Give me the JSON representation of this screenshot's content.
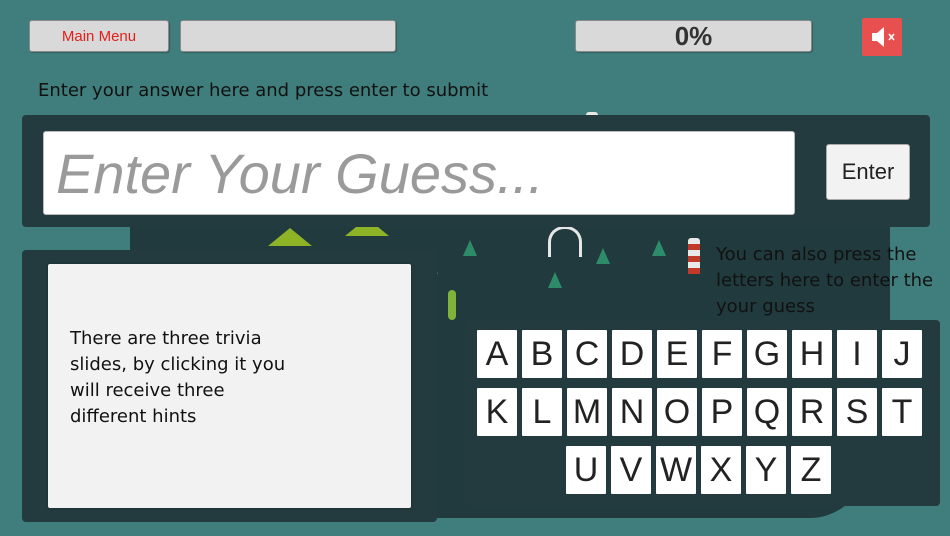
{
  "header": {
    "main_menu_label": "Main Menu",
    "progress_text": "0%",
    "progress_fraction": 0,
    "mute_icon": "speaker-muted-icon"
  },
  "guess": {
    "instruction": "Enter your answer here and press enter to submit",
    "placeholder": "Enter Your Guess...",
    "value": "",
    "enter_label": "Enter"
  },
  "hint": {
    "text": "There are three trivia slides, by clicking it you will receive three different hints"
  },
  "keyboard": {
    "instruction": "You can also press the letters here to enter the your guess",
    "rows": [
      [
        "A",
        "B",
        "C",
        "D",
        "E",
        "F",
        "G",
        "H",
        "I",
        "J"
      ],
      [
        "K",
        "L",
        "M",
        "N",
        "O",
        "P",
        "Q",
        "R",
        "S",
        "T"
      ],
      [
        "U",
        "V",
        "W",
        "X",
        "Y",
        "Z"
      ]
    ]
  },
  "colors": {
    "background": "#3f7e7c",
    "panel": "#233b3e",
    "main_menu_text": "#e3201b",
    "mute_button": "#e8504f"
  }
}
